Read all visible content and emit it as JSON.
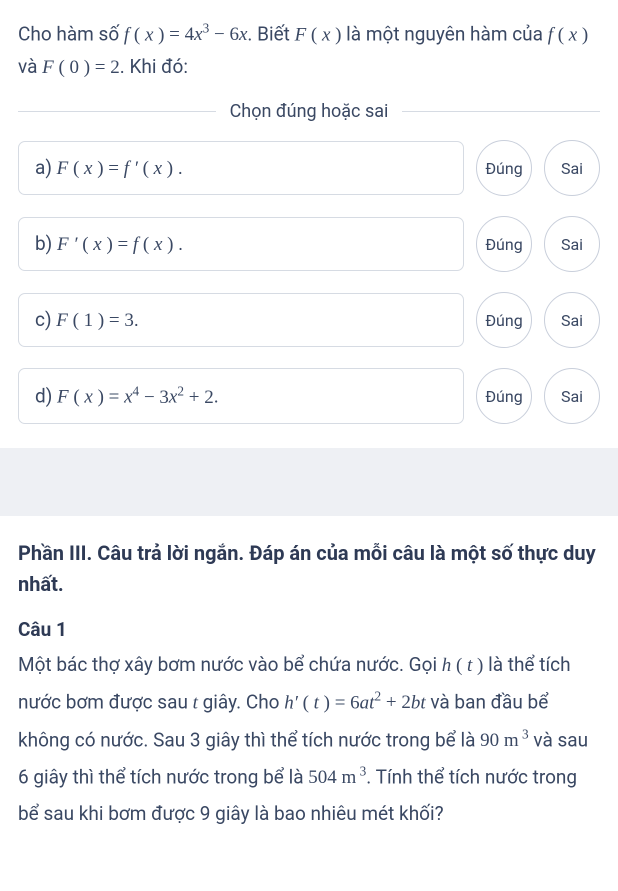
{
  "question": {
    "stem_html": "Cho hàm số <span class='math-i'>f</span> <span class='paren'>(</span> <span class='math-i'>x</span> <span class='paren'>)</span> <span class='math'>= 4<span class='math-i'>x</span><sup>3</sup> − 6<span class='math-i'>x</span></span>. Biết <span class='math-i'>F</span> <span class='paren'>(</span> <span class='math-i'>x</span> <span class='paren'>)</span> là một nguyên hàm của <span class='math-i'>f</span> <span class='paren'>(</span> <span class='math-i'>x</span> <span class='paren'>)</span> và <span class='math-i'>F</span> <span class='paren'>(</span> <span class='math'>0</span> <span class='paren'>)</span> <span class='math'>= 2</span>. Khi đó:",
    "divider_label": "Chọn đúng hoặc sai",
    "options": [
      {
        "label_html": "a) <span class='math-i'>F</span> <span class='paren'>(</span> <span class='math-i'>x</span> <span class='paren'>)</span> <span class='math'>=</span> <span class='math-i'>f ′</span> <span class='paren'>(</span> <span class='math-i'>x</span> <span class='paren'>)</span> ."
      },
      {
        "label_html": "b) <span class='math-i'>F ′</span> <span class='paren'>(</span> <span class='math-i'>x</span> <span class='paren'>)</span> <span class='math'>=</span> <span class='math-i'>f</span> <span class='paren'>(</span> <span class='math-i'>x</span> <span class='paren'>)</span> ."
      },
      {
        "label_html": "c) <span class='math-i'>F</span> <span class='paren'>(</span> <span class='math'>1</span> <span class='paren'>)</span> <span class='math'>= 3</span>."
      },
      {
        "label_html": "d) <span class='math-i'>F</span> <span class='paren'>(</span> <span class='math-i'>x</span> <span class='paren'>)</span> <span class='math'>= </span><span class='math-i'>x</span><span class='math'><sup>4</sup> − 3</span><span class='math-i'>x</span><span class='math'><sup>2</sup> + 2</span>."
      }
    ],
    "true_label": "Đúng",
    "false_label": "Sai"
  },
  "part3": {
    "title": "Phần III. Câu trả lời ngắn. Đáp án của mỗi câu là một số thực duy nhất.",
    "q_number": "Câu 1",
    "body_html": "Một bác thợ xây bơm nước vào bể chứa nước. Gọi <span class='math-i'>h</span> <span class='paren'>(</span> <span class='math-i'>t</span> <span class='paren'>)</span> là thể tích nước bơm được sau <span class='math-i'>t</span> giây. Cho <span class='math-i'>h′</span> <span class='paren'>(</span> <span class='math-i'>t</span> <span class='paren'>)</span> <span class='math'>= 6</span><span class='math-i'>a</span><span class='math-i'>t</span><span class='math'><sup>2</sup> + 2</span><span class='math-i'>b</span><span class='math-i'>t</span> và ban đầu bể không có nước. Sau 3 giây thì thể tích nước trong bể là <span class='math'>90 m<sup> 3</sup></span> và sau 6 giây thì thể tích nước trong bể là <span class='math'>504 m<sup> 3</sup></span>. Tính thể tích nước trong bể sau khi bơm được 9 giây là bao nhiêu mét khối?"
  }
}
